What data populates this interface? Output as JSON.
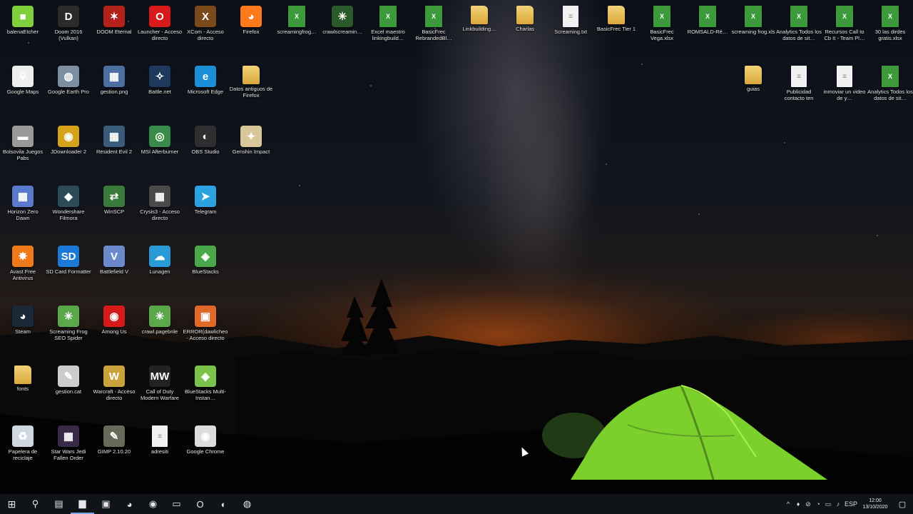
{
  "desktop": {
    "icons": [
      {
        "label": "balenaEtcher",
        "glyph": "■",
        "color": "#7fcf3a",
        "kind": "app"
      },
      {
        "label": "Doom 2016 (Vulkan)",
        "glyph": "D",
        "color": "#2b2b2b",
        "kind": "app"
      },
      {
        "label": "DOOM Eternal",
        "glyph": "✶",
        "color": "#b3221a",
        "kind": "app"
      },
      {
        "label": "Launcher - Acceso directo",
        "glyph": "O",
        "color": "#d91a1a",
        "kind": "app"
      },
      {
        "label": "XCom - Acceso directo",
        "glyph": "X",
        "color": "#7a4a1a",
        "kind": "app"
      },
      {
        "label": "Firefox",
        "glyph": "◕",
        "color": "#ff7a1a",
        "kind": "app"
      },
      {
        "label": "screamingfrog…",
        "glyph": "X",
        "color": "#3c9a3a",
        "kind": "sheet"
      },
      {
        "label": "crawlscreamin…",
        "glyph": "✳",
        "color": "#2a5a2a",
        "kind": "app"
      },
      {
        "label": "Excel maestro linkingbuild…",
        "glyph": "X",
        "color": "#3c9a3a",
        "kind": "sheet"
      },
      {
        "label": "BasicFrec RebrandedBl…",
        "glyph": "X",
        "color": "#3c9a3a",
        "kind": "sheet"
      },
      {
        "label": "Linkbuilding…",
        "glyph": "",
        "color": "#e6c25a",
        "kind": "folder"
      },
      {
        "label": "Charlas",
        "glyph": "",
        "color": "#e6c25a",
        "kind": "folder"
      },
      {
        "label": "Screaming.txt",
        "glyph": "≡",
        "color": "#eee",
        "kind": "doc"
      },
      {
        "label": "BasicFrec Tier 1",
        "glyph": "",
        "color": "#e6c25a",
        "kind": "folder"
      },
      {
        "label": "BasicFrec Vega.xlsx",
        "glyph": "X",
        "color": "#3c9a3a",
        "kind": "sheet"
      },
      {
        "label": "ROMSALD-Ré…",
        "glyph": "X",
        "color": "#3c9a3a",
        "kind": "sheet"
      },
      {
        "label": "screaming frog.xls",
        "glyph": "X",
        "color": "#3c9a3a",
        "kind": "sheet"
      },
      {
        "label": "Analytics Todos los datos de sit…",
        "glyph": "X",
        "color": "#3c9a3a",
        "kind": "sheet"
      },
      {
        "label": "Recursos Call to Cb It - Team Pl…",
        "glyph": "X",
        "color": "#3c9a3a",
        "kind": "sheet"
      },
      {
        "label": "30 las dirdes gratis.xlsx",
        "glyph": "X",
        "color": "#3c9a3a",
        "kind": "sheet"
      },
      {
        "label": "Google Maps",
        "glyph": "⚲",
        "color": "#eee",
        "kind": "app"
      },
      {
        "label": "Google Earth Pro",
        "glyph": "◍",
        "color": "#7d8fa3",
        "kind": "app"
      },
      {
        "label": "gestion.png",
        "glyph": "▦",
        "color": "#4a6fa0",
        "kind": "app"
      },
      {
        "label": "Battle.net",
        "glyph": "✧",
        "color": "#1d3a5e",
        "kind": "app"
      },
      {
        "label": "Microsoft Edge",
        "glyph": "e",
        "color": "#1a8fd6",
        "kind": "app"
      },
      {
        "label": "Datos antiguos de Firefox",
        "glyph": "",
        "color": "#e6c25a",
        "kind": "folder"
      },
      {
        "label": "guias",
        "glyph": "",
        "color": "#e6c25a",
        "kind": "folder"
      },
      {
        "label": "Publicidad contacto ten",
        "glyph": "≡",
        "color": "#eee",
        "kind": "doc"
      },
      {
        "label": "inmoviar un video de y…",
        "glyph": "≡",
        "color": "#eee",
        "kind": "doc"
      },
      {
        "label": "Analytics Todos los datos de sit…",
        "glyph": "X",
        "color": "#3c9a3a",
        "kind": "sheet"
      },
      {
        "label": "Bolsovila Juegos Pabs",
        "glyph": "▬",
        "color": "#999",
        "kind": "app"
      },
      {
        "label": "JDownloader 2",
        "glyph": "◉",
        "color": "#d6a21a",
        "kind": "app"
      },
      {
        "label": "Resident Evil 2",
        "glyph": "▦",
        "color": "#3a5c7a",
        "kind": "app"
      },
      {
        "label": "MSI Afterburner",
        "glyph": "◎",
        "color": "#3a8c4a",
        "kind": "app"
      },
      {
        "label": "OBS Studio",
        "glyph": "◐",
        "color": "#302e31",
        "kind": "app"
      },
      {
        "label": "Genshin Impact",
        "glyph": "✦",
        "color": "#d9c79a",
        "kind": "app"
      },
      {
        "label": "Horizon Zero Dawn",
        "glyph": "▦",
        "color": "#5a7acc",
        "kind": "app"
      },
      {
        "label": "Wondershare Filmora",
        "glyph": "◆",
        "color": "#2d4a58",
        "kind": "app"
      },
      {
        "label": "WinSCP",
        "glyph": "⇄",
        "color": "#3a7a3a",
        "kind": "app"
      },
      {
        "label": "Crysis3 - Acceso directo",
        "glyph": "▦",
        "color": "#4a4a4a",
        "kind": "app"
      },
      {
        "label": "Telegram",
        "glyph": "➤",
        "color": "#2aa3e0",
        "kind": "app"
      },
      {
        "label": "Avast Free Antivirus",
        "glyph": "✸",
        "color": "#f07a1a",
        "kind": "app"
      },
      {
        "label": "SD Card Formatter",
        "glyph": "SD",
        "color": "#1a7ad6",
        "kind": "app"
      },
      {
        "label": "Battlefield V",
        "glyph": "V",
        "color": "#6a8acc",
        "kind": "app"
      },
      {
        "label": "Lunagen",
        "glyph": "☁",
        "color": "#2a9ad6",
        "kind": "app"
      },
      {
        "label": "BlueStacks",
        "glyph": "◈",
        "color": "#4aa84a",
        "kind": "app"
      },
      {
        "label": "Steam",
        "glyph": "◕",
        "color": "#1b2838",
        "kind": "app"
      },
      {
        "label": "Screaming Frog SEO Spider",
        "glyph": "✳",
        "color": "#5aa84a",
        "kind": "app"
      },
      {
        "label": "Among Us",
        "glyph": "◉",
        "color": "#d61a1a",
        "kind": "app"
      },
      {
        "label": "crawl.pagebrile",
        "glyph": "✳",
        "color": "#5aa84a",
        "kind": "app"
      },
      {
        "label": "ERROR(dawlicheo - Acceso directo",
        "glyph": "▣",
        "color": "#e06a2a",
        "kind": "app"
      },
      {
        "label": "fonts",
        "glyph": "",
        "color": "#e6c25a",
        "kind": "folder"
      },
      {
        "label": "gestion.cat",
        "glyph": "✎",
        "color": "#ccc",
        "kind": "app"
      },
      {
        "label": "Warcraft - Acceso directo",
        "glyph": "W",
        "color": "#c9a23a",
        "kind": "app"
      },
      {
        "label": "Call of Duty Modern Warfare",
        "glyph": "MW",
        "color": "#222",
        "kind": "app"
      },
      {
        "label": "BlueStacks Multi-Instan…",
        "glyph": "◈",
        "color": "#7ac24a",
        "kind": "app"
      },
      {
        "label": "Papelera de reciclaje",
        "glyph": "♻",
        "color": "#cfd8e0",
        "kind": "app"
      },
      {
        "label": "Star Wars Jedi Fallen Order",
        "glyph": "▦",
        "color": "#3a2a4a",
        "kind": "app"
      },
      {
        "label": "GIMP 2.10.20",
        "glyph": "✎",
        "color": "#6a6a5a",
        "kind": "app"
      },
      {
        "label": "adresiti",
        "glyph": "≡",
        "color": "#eee",
        "kind": "doc"
      },
      {
        "label": "Google Chrome",
        "glyph": "◉",
        "color": "#dcdcdc",
        "kind": "app"
      }
    ]
  },
  "taskbar": {
    "items": [
      {
        "name": "start-button",
        "glyph": "⊞"
      },
      {
        "name": "search-icon",
        "glyph": "⚲"
      },
      {
        "name": "task-view-icon",
        "glyph": "▤"
      },
      {
        "name": "file-explorer-icon",
        "glyph": "▆"
      },
      {
        "name": "store-icon",
        "glyph": "▣"
      },
      {
        "name": "steam-icon",
        "glyph": "◕"
      },
      {
        "name": "chrome-icon",
        "glyph": "◉"
      },
      {
        "name": "monitor-icon",
        "glyph": "▭"
      },
      {
        "name": "opera-icon",
        "glyph": "O"
      },
      {
        "name": "obs-icon",
        "glyph": "◐"
      },
      {
        "name": "balena-icon",
        "glyph": "◍"
      }
    ],
    "tray": [
      "^",
      "♦",
      "⊘",
      "◔",
      "▭",
      "♪",
      "ESP"
    ],
    "clock_time": "12:00",
    "clock_date": "13/10/2020",
    "notification_glyph": "▢"
  }
}
